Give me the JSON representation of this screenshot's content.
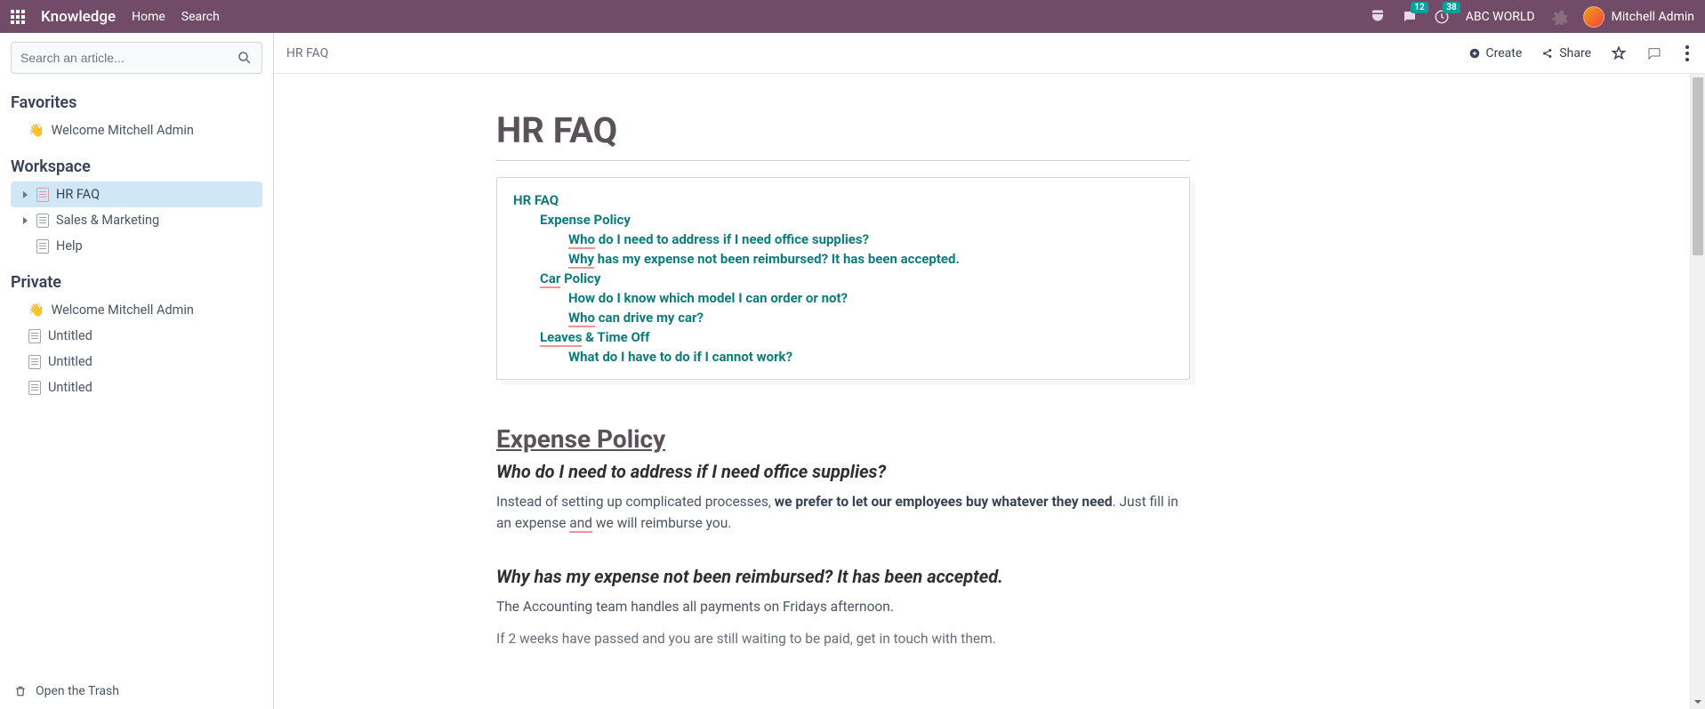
{
  "nav": {
    "brand": "Knowledge",
    "home": "Home",
    "search": "Search",
    "chat_badge": "12",
    "clock_badge": "38",
    "company": "ABC WORLD",
    "user": "Mitchell Admin"
  },
  "sidebar": {
    "search_placeholder": "Search an article...",
    "favorites_title": "Favorites",
    "fav_items": [
      {
        "icon": "👋",
        "label": "Welcome Mitchell Admin"
      }
    ],
    "workspace_title": "Workspace",
    "workspace_items": [
      {
        "label": "HR FAQ",
        "active": true,
        "caret": true,
        "iconType": "doc-red"
      },
      {
        "label": "Sales & Marketing",
        "caret": true,
        "iconType": "doc"
      },
      {
        "label": "Help",
        "iconType": "doc"
      }
    ],
    "private_title": "Private",
    "private_items": [
      {
        "icon": "👋",
        "label": "Welcome Mitchell Admin"
      },
      {
        "iconType": "doc",
        "label": "Untitled"
      },
      {
        "iconType": "doc",
        "label": "Untitled"
      },
      {
        "iconType": "doc",
        "label": "Untitled"
      }
    ],
    "trash": "Open the Trash"
  },
  "toolbar": {
    "breadcrumb": "HR FAQ",
    "create": "Create",
    "share": "Share"
  },
  "article": {
    "title": "HR FAQ",
    "toc": {
      "root": "HR FAQ",
      "s1": "Expense Policy",
      "s1q1_a": "Who",
      "s1q1_b": " do I need to address if I need office supplies?",
      "s1q2_a": "Why",
      "s1q2_b": " has my expense not been reimbursed? It has been accepted.",
      "s2_a": "Car",
      "s2_b": " Policy",
      "s2q1": "How do I know which model I can order or not?",
      "s2q2_a": "Who",
      "s2q2_b": " can drive my car?",
      "s3_a": "Leaves",
      "s3_b": " & Time Off",
      "s3q1": "What do I have to do if I cannot work?"
    },
    "h2_expense": "Expense Policy",
    "h3_q1": "Who do I need to address if I need office supplies?",
    "p1_a": "Instead of setting up complicated processes, ",
    "p1_b": "we prefer to let our employees buy whatever they need",
    "p1_c": ". Just fill in an expense ",
    "p1_d": "and",
    "p1_e": " we will reimburse you.",
    "h3_q2": "Why has my expense not been reimbursed? It has been accepted.",
    "p2": "The Accounting team handles all payments on Fridays afternoon.",
    "p3": "If 2 weeks have passed and you are still waiting to be paid, get in touch with them."
  }
}
